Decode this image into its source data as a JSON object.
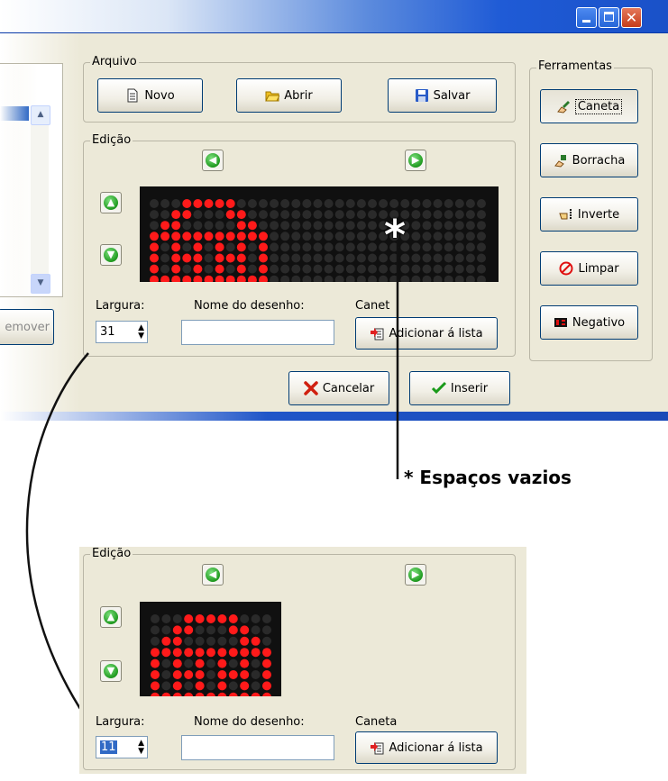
{
  "window": {
    "controls": {
      "minimize": "minimize",
      "maximize": "maximize",
      "close": "close"
    },
    "left_button": "emover"
  },
  "arquivo": {
    "legend": "Arquivo",
    "novo": "Novo",
    "abrir": "Abrir",
    "salvar": "Salvar"
  },
  "ferramentas": {
    "legend": "Ferramentas",
    "caneta": "Caneta",
    "borracha": "Borracha",
    "inverte": "Inverte",
    "limpar": "Limpar",
    "negativo": "Negativo"
  },
  "edicao": {
    "legend": "Edição",
    "largura_label": "Largura:",
    "largura_value": "31",
    "nome_label": "Nome do desenho:",
    "caneta_label": "Canet",
    "add_button": "Adicionar á lista",
    "nome_value": ""
  },
  "dialog": {
    "cancelar": "Cancelar",
    "inserir": "Inserir"
  },
  "callout": {
    "asterisk": "*",
    "text": "* Espaços vazios"
  },
  "edicao_detail": {
    "legend": "Edição",
    "largura_label": "Largura:",
    "largura_value": "11",
    "nome_label": "Nome do desenho:",
    "caneta_label": "Caneta",
    "add_button": "Adicionar á lista",
    "nome_value": ""
  },
  "colors": {
    "led_on": "#ff1a1a",
    "led_off": "#2a2a2a",
    "panel": "#101010",
    "accent": "#1f55c8"
  }
}
